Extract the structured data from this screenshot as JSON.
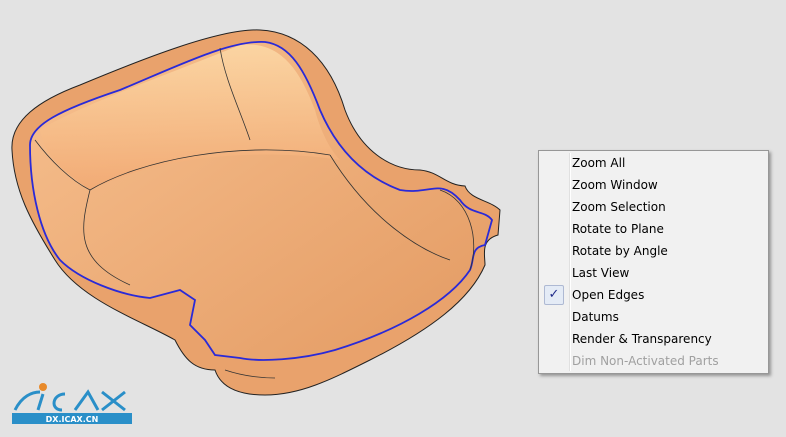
{
  "menu": {
    "items": [
      {
        "label": "Zoom All",
        "checked": false,
        "enabled": true
      },
      {
        "label": "Zoom Window",
        "checked": false,
        "enabled": true
      },
      {
        "label": "Zoom Selection",
        "checked": false,
        "enabled": true
      },
      {
        "label": "Rotate to Plane",
        "checked": false,
        "enabled": true
      },
      {
        "label": "Rotate by Angle",
        "checked": false,
        "enabled": true
      },
      {
        "label": "Last View",
        "checked": false,
        "enabled": true
      },
      {
        "label": "Open Edges",
        "checked": true,
        "enabled": true
      },
      {
        "label": "Datums",
        "checked": false,
        "enabled": true
      },
      {
        "label": "Render & Transparency",
        "checked": false,
        "enabled": true
      },
      {
        "label": "Dim Non-Activated Parts",
        "checked": false,
        "enabled": false
      }
    ],
    "check_glyph": "✓"
  },
  "logo": {
    "text": "ICAX",
    "url_text": "DX.ICAX.CN"
  },
  "colors": {
    "part": "#f4b07a",
    "open_edge": "#2a2ad8",
    "background": "#e3e3e3"
  }
}
